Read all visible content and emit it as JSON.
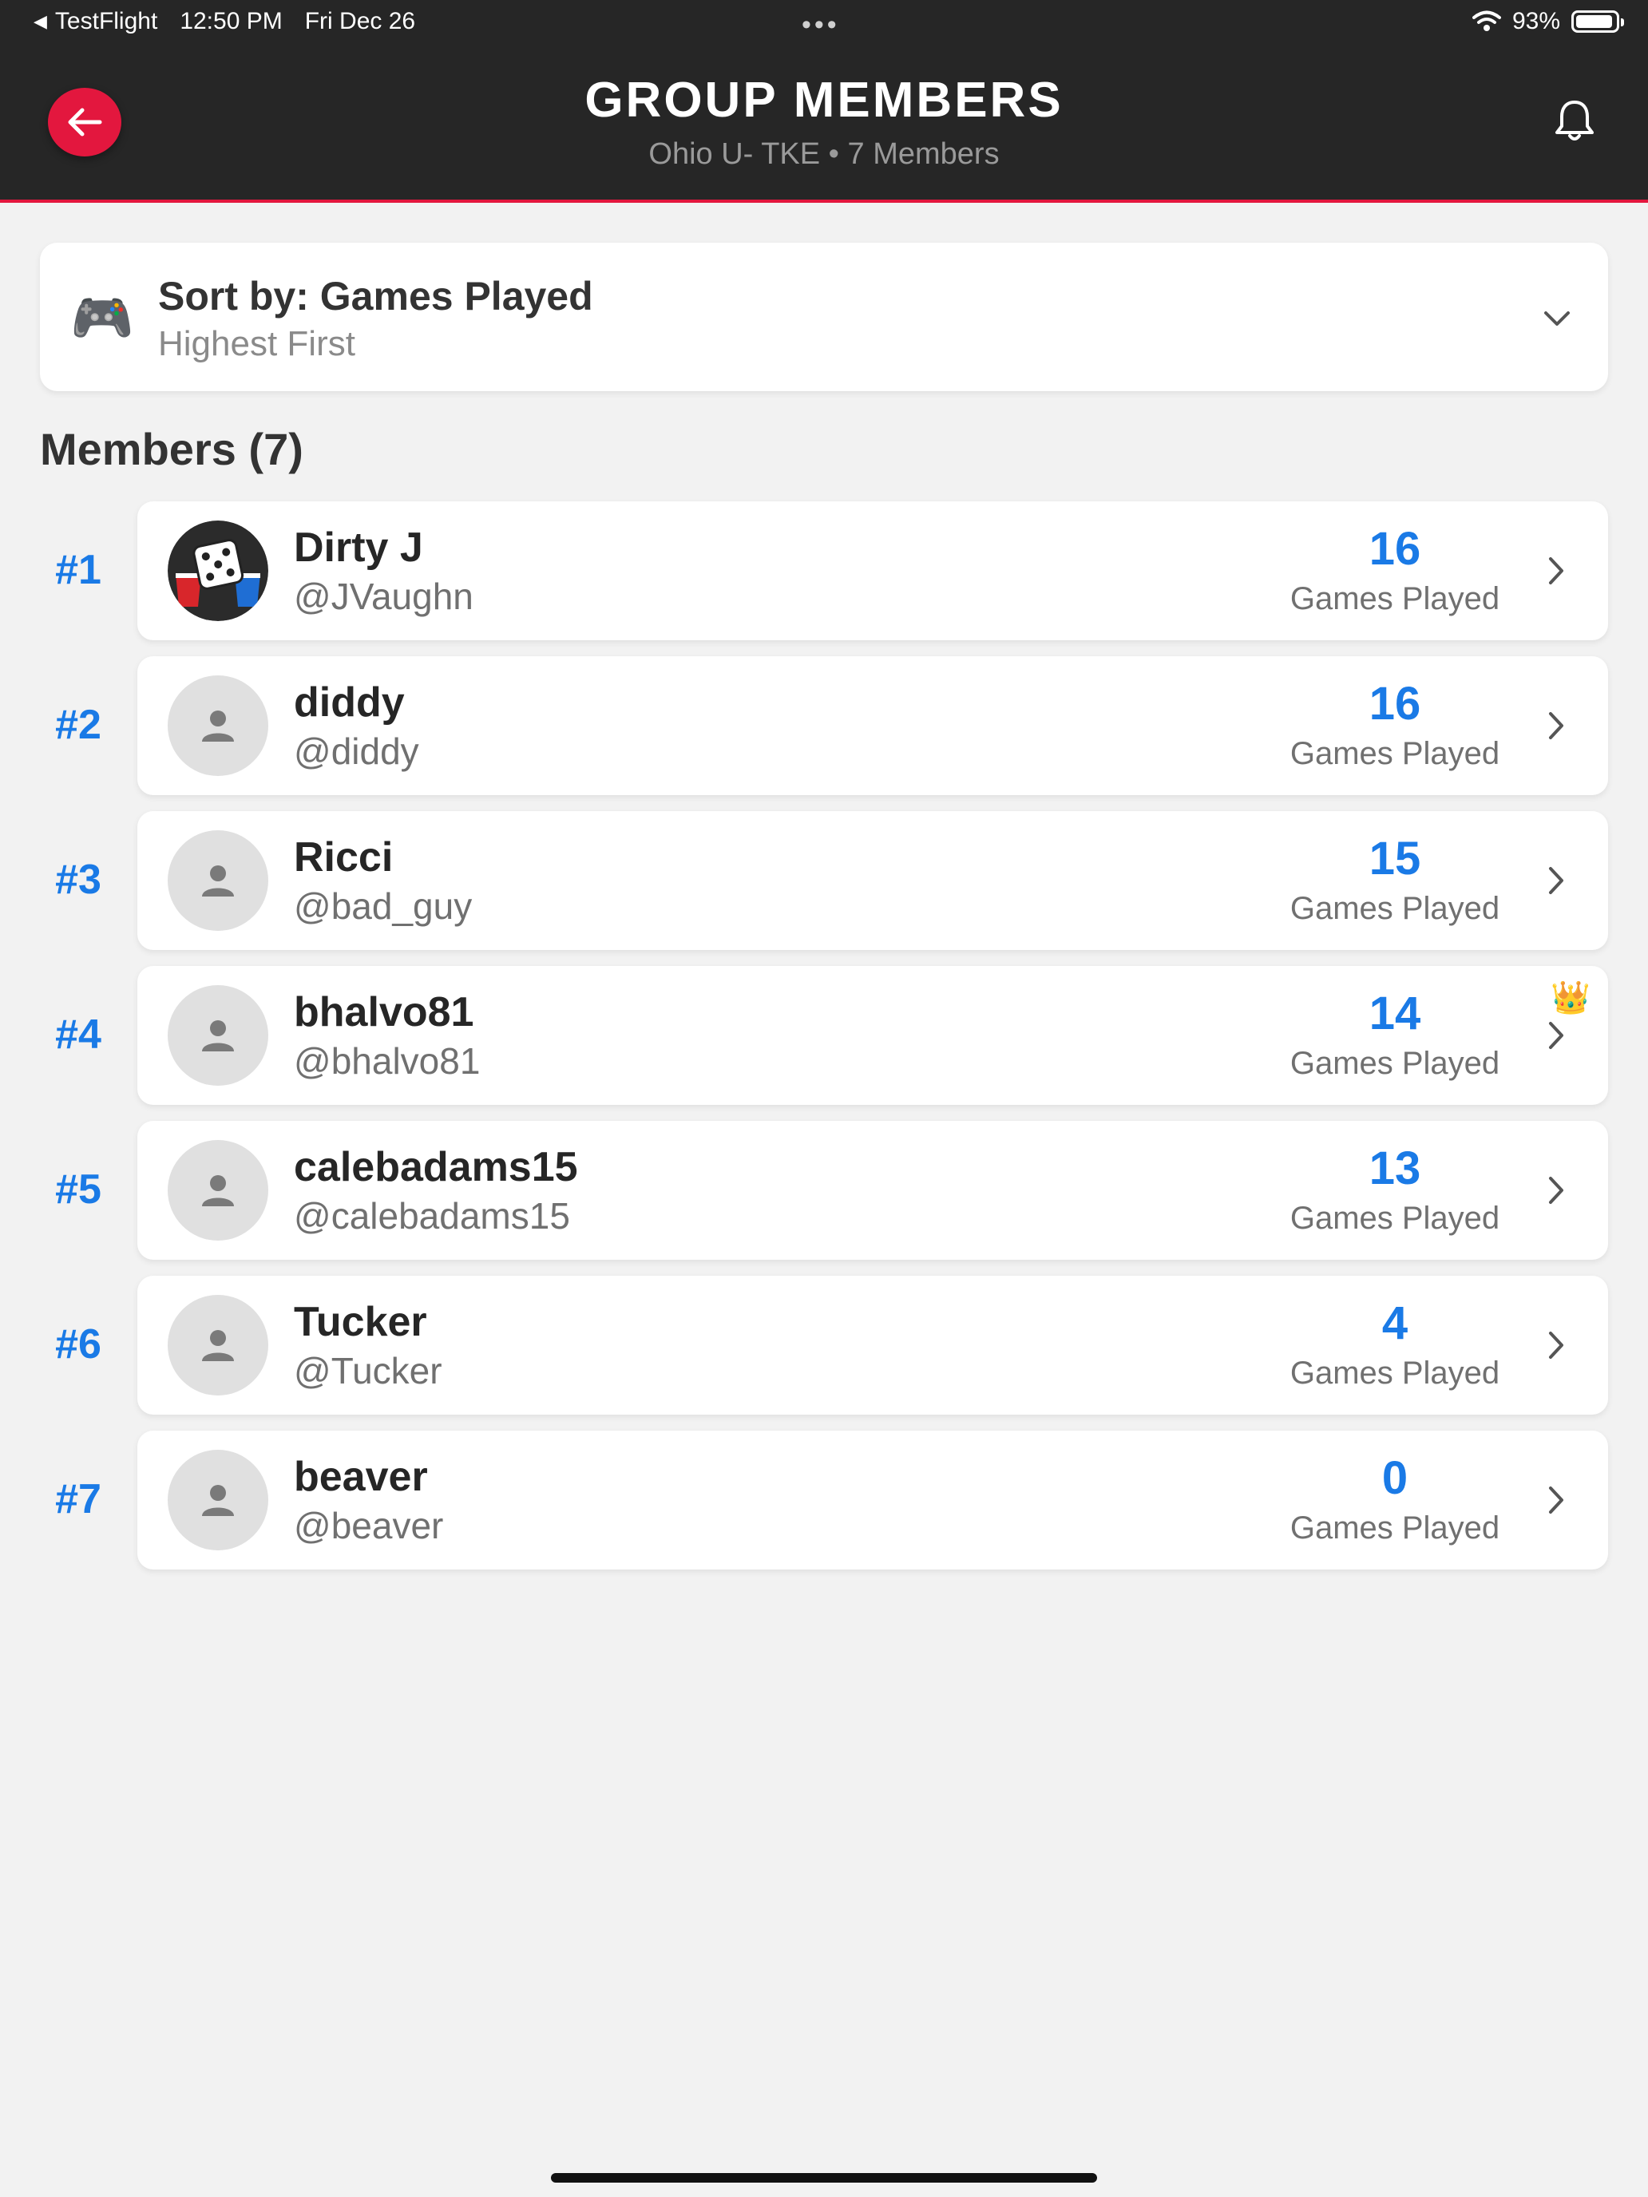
{
  "status_bar": {
    "app": "TestFlight",
    "time": "12:50 PM",
    "date": "Fri Dec 26",
    "dots": "•••",
    "battery": "93%",
    "battery_level": 0.93
  },
  "header": {
    "title": "GROUP MEMBERS",
    "subtitle": "Ohio U- TKE • 7 Members",
    "accent_color": "#e3173e",
    "background": "#262626"
  },
  "sort": {
    "icon": "game-controller-icon",
    "icon_glyph": "🎮",
    "title": "Sort by: Games Played",
    "subtitle": "Highest First"
  },
  "members_heading": "Members (7)",
  "members": [
    {
      "rank": "#1",
      "name": "Dirty J",
      "handle": "@JVaughn",
      "value": "16",
      "label": "Games Played",
      "avatar": "dice-cups-image",
      "crown": false
    },
    {
      "rank": "#2",
      "name": "diddy",
      "handle": "@diddy",
      "value": "16",
      "label": "Games Played",
      "avatar": "default-person",
      "crown": false
    },
    {
      "rank": "#3",
      "name": "Ricci",
      "handle": "@bad_guy",
      "value": "15",
      "label": "Games Played",
      "avatar": "default-person",
      "crown": false
    },
    {
      "rank": "#4",
      "name": "bhalvo81",
      "handle": "@bhalvo81",
      "value": "14",
      "label": "Games Played",
      "avatar": "default-person",
      "crown": true
    },
    {
      "rank": "#5",
      "name": "calebadams15",
      "handle": "@calebadams15",
      "value": "13",
      "label": "Games Played",
      "avatar": "default-person",
      "crown": false
    },
    {
      "rank": "#6",
      "name": "Tucker",
      "handle": "@Tucker",
      "value": "4",
      "label": "Games Played",
      "avatar": "default-person",
      "crown": false
    },
    {
      "rank": "#7",
      "name": "beaver",
      "handle": "@beaver",
      "value": "0",
      "label": "Games Played",
      "avatar": "default-person",
      "crown": false
    }
  ],
  "crown_glyph": "👑",
  "accent_blue": "#1a7ae6"
}
